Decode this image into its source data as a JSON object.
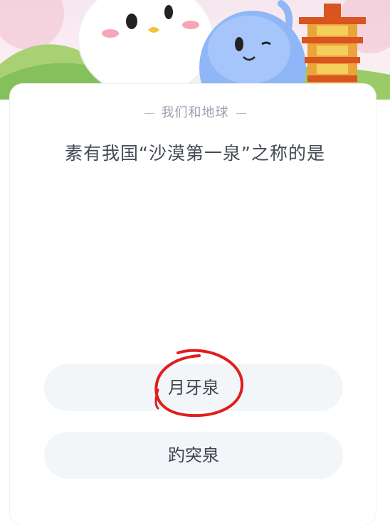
{
  "quiz": {
    "category": "我们和地球",
    "question": "素有我国“沙漠第一泉”之称的是",
    "options": [
      {
        "label": "月牙泉"
      },
      {
        "label": "趵突泉"
      }
    ]
  },
  "colors": {
    "option_bg": "#f3f6f8",
    "annotation_red": "#e11d1d",
    "category_text": "#9aa1ad",
    "question_text": "#444a56"
  },
  "icons": [
    "ghost-mascot-illustration",
    "blue-dragon-mascot-illustration",
    "pagoda-illustration",
    "hand-drawn-circle-annotation"
  ]
}
